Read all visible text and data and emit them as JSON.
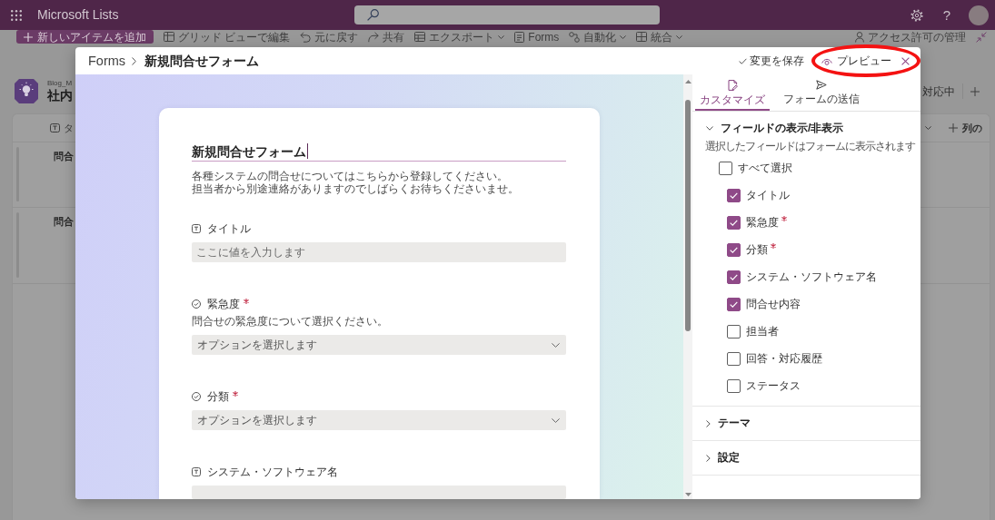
{
  "app_bar": {
    "title": "Microsoft Lists",
    "help": "?"
  },
  "command_bar": {
    "items": [
      {
        "kind": "new",
        "label": "新しいアイテムを追加",
        "dropdown": false
      },
      {
        "kind": "grid",
        "label": "グリッド ビューで編集",
        "dropdown": false
      },
      {
        "kind": "undo",
        "label": "元に戻す",
        "dropdown": false
      },
      {
        "kind": "share",
        "label": "共有",
        "dropdown": false
      },
      {
        "kind": "export",
        "label": "エクスポート",
        "dropdown": true
      },
      {
        "kind": "forms",
        "label": "Forms",
        "dropdown": false
      },
      {
        "kind": "automate",
        "label": "自動化",
        "dropdown": true
      },
      {
        "kind": "integrate",
        "label": "統合",
        "dropdown": true
      }
    ],
    "right_items": [
      {
        "kind": "access",
        "label": "アクセス許可の管理"
      }
    ]
  },
  "list": {
    "site": "Blog_M",
    "title": "社内",
    "view": "対応中",
    "column": "タ",
    "add_column": "列の",
    "rows": [
      {
        "title": "問合"
      },
      {
        "title": "問合"
      }
    ]
  },
  "dialog": {
    "breadcrumb": {
      "parent": "Forms",
      "current": "新規問合せフォーム"
    },
    "save": "変更を保存",
    "preview": "プレビュー",
    "form": {
      "title": "新規問合せフォーム",
      "description": [
        "各種システムの問合せについてはこちらから登録してください。",
        "担当者から別途連絡がありますのでしばらくお待ちくださいませ。"
      ],
      "fields": [
        {
          "kind": "text",
          "label": "タイトル",
          "required": false,
          "placeholder": "ここに値を入力します"
        },
        {
          "kind": "choice",
          "label": "緊急度",
          "required": true,
          "description": "問合せの緊急度について選択ください。",
          "placeholder": "オプションを選択します"
        },
        {
          "kind": "choice",
          "label": "分類",
          "required": true,
          "placeholder": "オプションを選択します"
        },
        {
          "kind": "text",
          "label": "システム・ソフトウェア名",
          "required": false
        }
      ]
    },
    "panel": {
      "tabs": [
        {
          "kind": "customize",
          "label": "カスタマイズ",
          "selected": true
        },
        {
          "kind": "send",
          "label": "フォームの送信",
          "selected": false
        }
      ],
      "sections": [
        {
          "title": "フィールドの表示/非表示",
          "expanded": true,
          "hint": "選択したフィールドはフォームに表示されます",
          "select_all": {
            "label": "すべて選択",
            "checked": false
          },
          "fields": [
            {
              "label": "タイトル",
              "checked": true,
              "required": false
            },
            {
              "label": "緊急度",
              "checked": true,
              "required": true
            },
            {
              "label": "分類",
              "checked": true,
              "required": true
            },
            {
              "label": "システム・ソフトウェア名",
              "checked": true,
              "required": false
            },
            {
              "label": "問合せ内容",
              "checked": true,
              "required": false
            },
            {
              "label": "担当者",
              "checked": false,
              "required": false
            },
            {
              "label": "回答・対応履歴",
              "checked": false,
              "required": false
            },
            {
              "label": "ステータス",
              "checked": false,
              "required": false
            }
          ]
        },
        {
          "title": "テーマ",
          "expanded": false
        },
        {
          "title": "設定",
          "expanded": false
        }
      ]
    }
  }
}
